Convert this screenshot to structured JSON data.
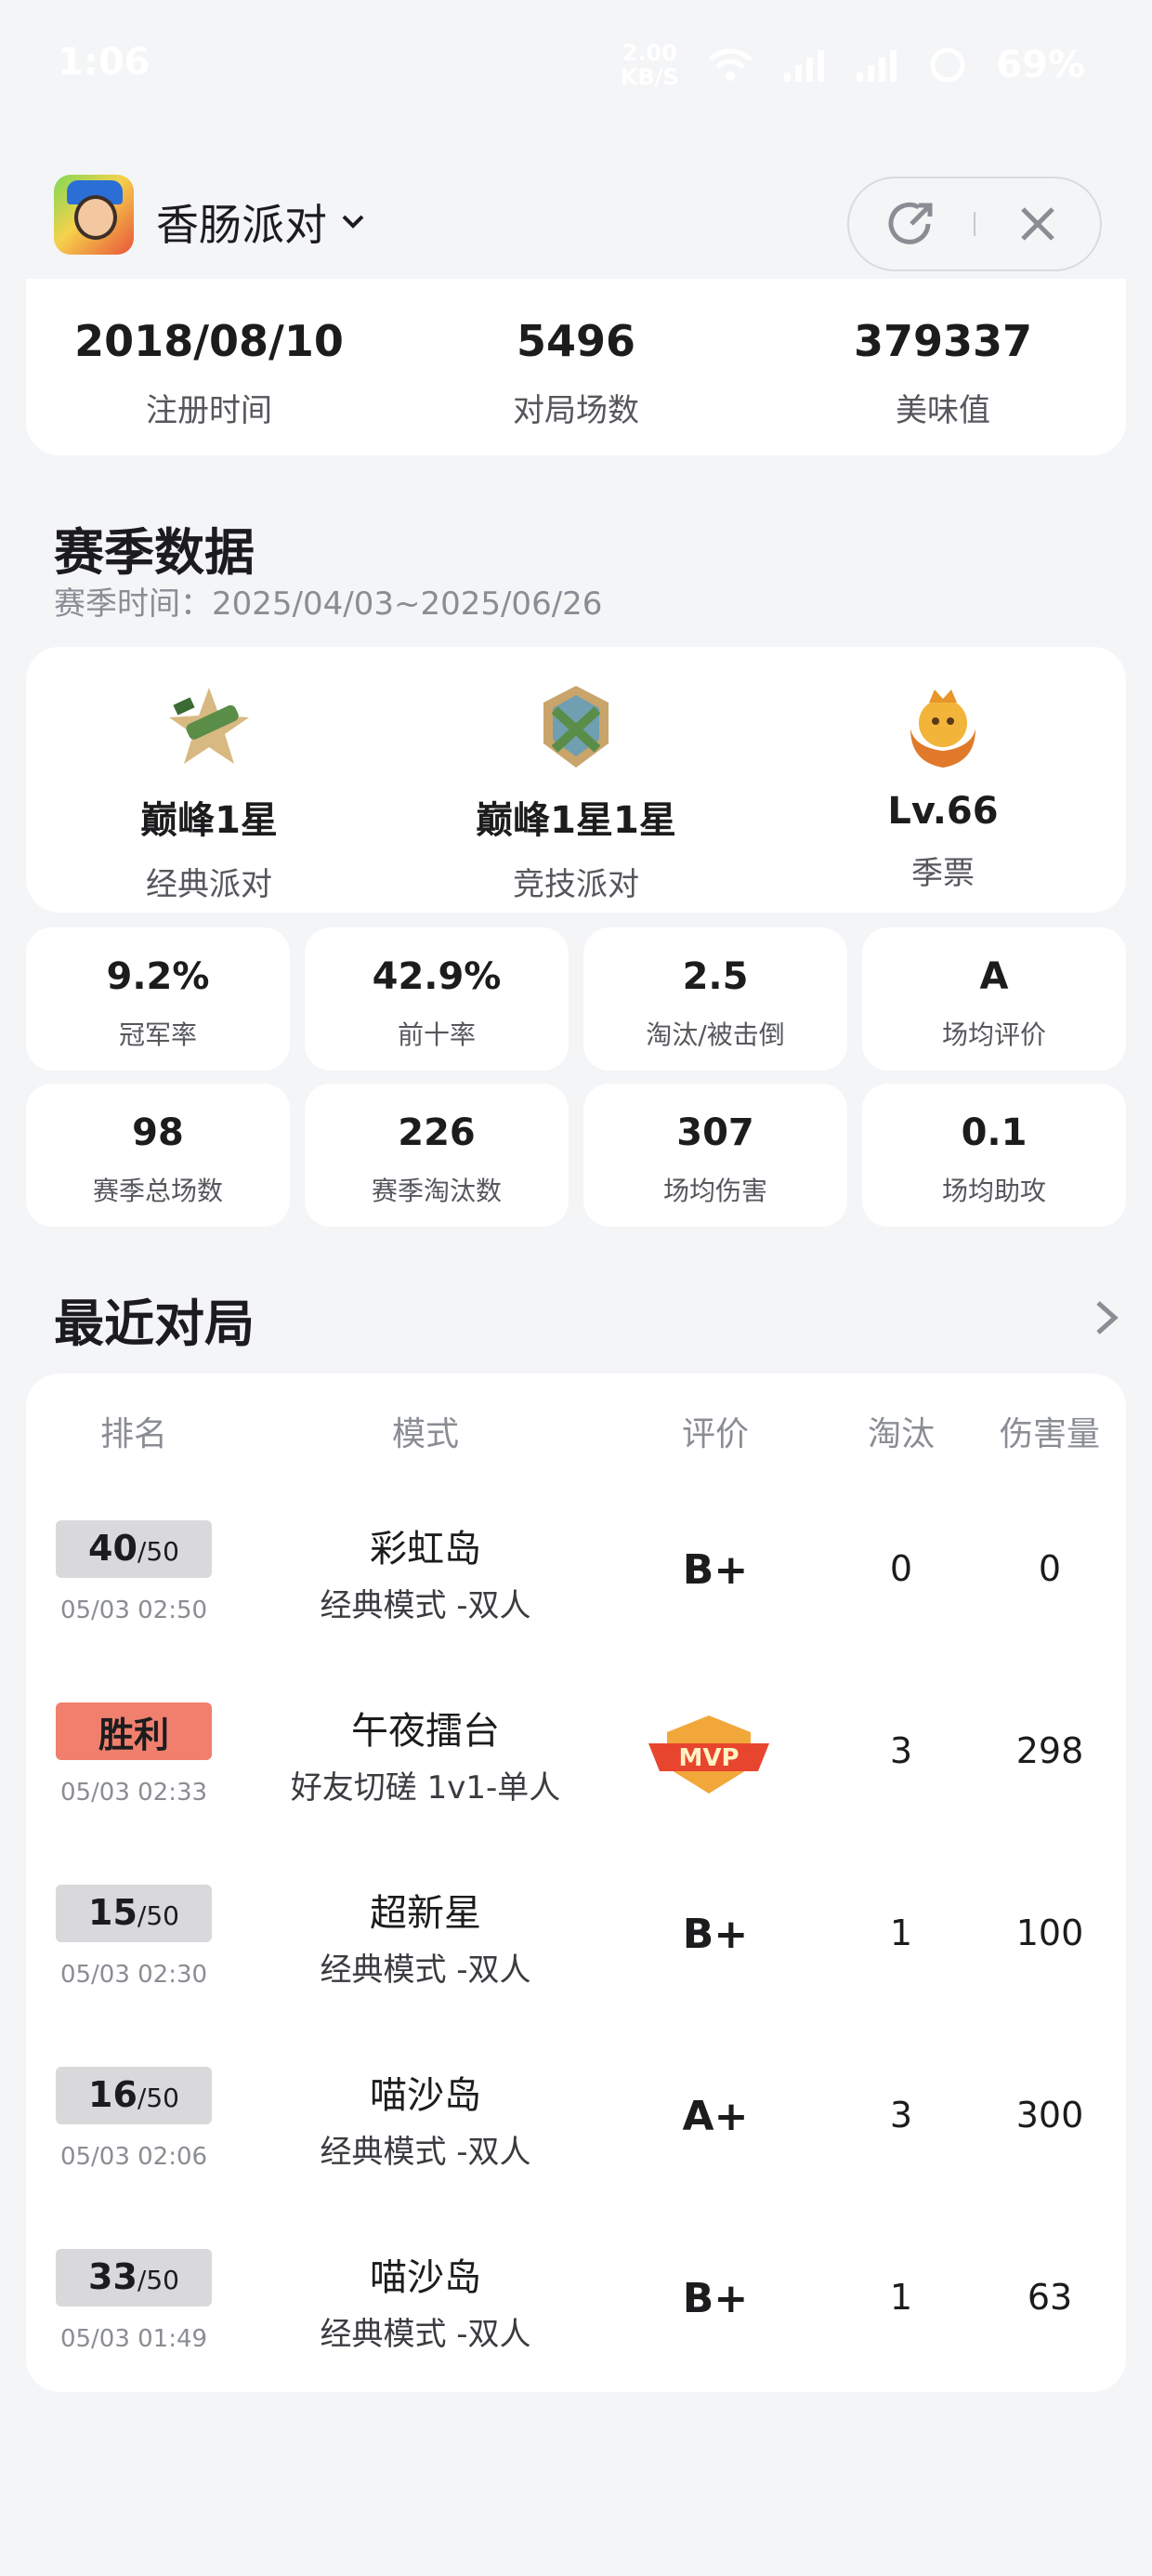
{
  "status_bar": {
    "time": "1:06",
    "speed": "2.00 KB/S",
    "battery": "69%"
  },
  "header": {
    "app_name": "香肠派对",
    "icons": [
      "app-logo-icon",
      "chevron-down-icon",
      "share-icon",
      "close-icon"
    ]
  },
  "profile_stats": [
    {
      "value": "2018/08/10",
      "label": "注册时间"
    },
    {
      "value": "5496",
      "label": "对局场数"
    },
    {
      "value": "379337",
      "label": "美味值"
    }
  ],
  "season": {
    "title": "赛季数据",
    "period": "赛季时间：2025/04/03~2025/06/26",
    "ranks": [
      {
        "name": "巅峰1星",
        "sub": "经典派对",
        "icon": "classic-rank-badge-icon"
      },
      {
        "name": "巅峰1星1星",
        "sub": "竞技派对",
        "icon": "competitive-rank-badge-icon"
      },
      {
        "name": "Lv.66",
        "sub": "季票",
        "icon": "season-pass-badge-icon"
      }
    ],
    "stats_row1": [
      {
        "value": "9.2%",
        "label": "冠军率"
      },
      {
        "value": "42.9%",
        "label": "前十率"
      },
      {
        "value": "2.5",
        "label": "淘汰/被击倒"
      },
      {
        "value": "A",
        "label": "场均评价"
      }
    ],
    "stats_row2": [
      {
        "value": "98",
        "label": "赛季总场数"
      },
      {
        "value": "226",
        "label": "赛季淘汰数"
      },
      {
        "value": "307",
        "label": "场均伤害"
      },
      {
        "value": "0.1",
        "label": "场均助攻"
      }
    ]
  },
  "recent": {
    "title": "最近对局",
    "headers": [
      "排名",
      "模式",
      "评价",
      "淘汰",
      "伤害量"
    ],
    "matches": [
      {
        "rank": "40",
        "total": "/50",
        "win": false,
        "date": "05/03 02:50",
        "map": "彩虹岛",
        "mode": "经典模式 -双人",
        "grade": "B+",
        "kills": "0",
        "damage": "0"
      },
      {
        "rank": "胜利",
        "total": "",
        "win": true,
        "date": "05/03 02:33",
        "map": "午夜擂台",
        "mode": "好友切磋 1v1-单人",
        "grade": "MVP",
        "kills": "3",
        "damage": "298"
      },
      {
        "rank": "15",
        "total": "/50",
        "win": false,
        "date": "05/03 02:30",
        "map": "超新星",
        "mode": "经典模式 -双人",
        "grade": "B+",
        "kills": "1",
        "damage": "100"
      },
      {
        "rank": "16",
        "total": "/50",
        "win": false,
        "date": "05/03 02:06",
        "map": "喵沙岛",
        "mode": "经典模式 -双人",
        "grade": "A+",
        "kills": "3",
        "damage": "300"
      },
      {
        "rank": "33",
        "total": "/50",
        "win": false,
        "date": "05/03 01:49",
        "map": "喵沙岛",
        "mode": "经典模式 -双人",
        "grade": "B+",
        "kills": "1",
        "damage": "63"
      }
    ]
  },
  "colors": {
    "background": "#f4f5f7",
    "card": "#ffffff",
    "win_badge": "#f07f6d",
    "rank_badge": "#d9d9dc",
    "muted_text": "#8a8d93"
  }
}
